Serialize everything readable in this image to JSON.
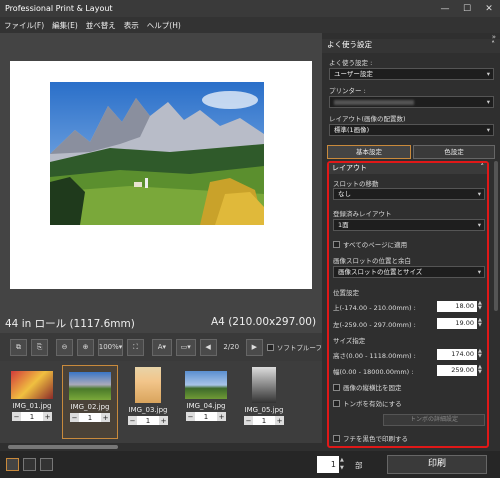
{
  "window": {
    "title": "Professional Print & Layout"
  },
  "menu": [
    "ファイル(F)",
    "編集(E)",
    "並べ替え",
    "表示",
    "ヘルプ(H)"
  ],
  "preview": {
    "roll_size": "44 in ロール (1117.6mm)",
    "paper_size": "A4 (210.00x297.00)"
  },
  "toolbar": {
    "zoom": "100%",
    "page": "2/20",
    "softproof": "ソフトプルーフ"
  },
  "thumbnails": [
    {
      "name": "IMG_01.jpg",
      "qty": "1",
      "selected": false
    },
    {
      "name": "IMG_02.jpg",
      "qty": "1",
      "selected": true
    },
    {
      "name": "IMG_03.jpg",
      "qty": "1",
      "selected": false
    },
    {
      "name": "IMG_04.jpg",
      "qty": "1",
      "selected": false
    },
    {
      "name": "IMG_05.jpg",
      "qty": "1",
      "selected": false
    }
  ],
  "panel": {
    "header": "よく使う設定",
    "favorites_label": "よく使う設定 :",
    "favorites_value": "ユーザー設定",
    "printer_label": "プリンター :",
    "layout_label": "レイアウト(画像の配置数)",
    "layout_value": "標準(1画像)",
    "tab_basic": "基本設定",
    "tab_color": "色設定"
  },
  "layout_section": {
    "title": "レイアウト",
    "slot_move_label": "スロットの移動",
    "slot_move_value": "なし",
    "registered_label": "登録済みレイアウト",
    "registered_value": "1面",
    "apply_all": "すべてのページに適用",
    "img_pos_label": "画像スロットの位置と余白",
    "img_pos_value": "画像スロットの位置とサイズ",
    "pos_setting": "位置設定",
    "top_label": "上(-174.00 - 210.00mm) :",
    "top_value": "18.00",
    "left_label": "左(-259.00 - 297.00mm) :",
    "left_value": "19.00",
    "size_setting": "サイズ指定",
    "height_label": "高さ(0.00 - 1118.00mm) :",
    "height_value": "174.00",
    "width_label": "幅(0.00 - 18000.00mm) :",
    "width_value": "259.00",
    "fix_aspect": "画像の縦横比を固定",
    "crop_marks": "トンボを有効にする",
    "crop_detail_btn": "トンボの詳細設定",
    "print_black": "フチを黒色で印刷する"
  },
  "bottom": {
    "copies": "1",
    "copies_unit": "部",
    "print": "印刷"
  }
}
